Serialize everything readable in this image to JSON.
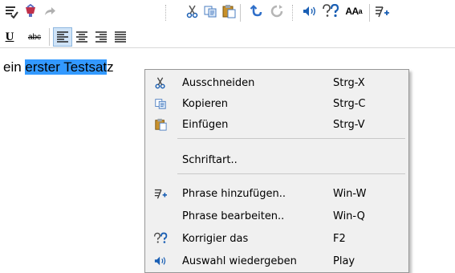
{
  "toolbar": {
    "icons": [
      "spell-check-icon",
      "paint-icon",
      "redo-arrow-icon",
      "cut-icon",
      "copy-icon",
      "paste-icon",
      "undo-icon",
      "refresh-icon",
      "speaker-icon",
      "correct-icon",
      "font-size-icon",
      "add-phrase-icon"
    ],
    "font_size_big": "AA",
    "font_size_small": "a",
    "underline_label": "U",
    "strikethrough_label": "abc"
  },
  "editor": {
    "text_before": "ein ",
    "text_selected": "erster Testsat",
    "text_after": "z"
  },
  "context_menu": {
    "items": [
      {
        "icon": "cut-icon",
        "label": "Ausschneiden",
        "shortcut": "Strg-X"
      },
      {
        "icon": "copy-icon",
        "label": "Kopieren",
        "shortcut": "Strg-C"
      },
      {
        "icon": "paste-icon",
        "label": "Einfügen",
        "shortcut": "Strg-V"
      },
      {
        "icon": "",
        "label": "Schriftart..",
        "shortcut": ""
      },
      {
        "icon": "add-phrase-icon",
        "label": "Phrase hinzufügen..",
        "shortcut": "Win-W"
      },
      {
        "icon": "",
        "label": "Phrase bearbeiten..",
        "shortcut": "Win-Q"
      },
      {
        "icon": "correct-icon",
        "label": "Korrigier das",
        "shortcut": "F2"
      },
      {
        "icon": "speaker-icon",
        "label": "Auswahl wiedergeben",
        "shortcut": "Play"
      }
    ]
  },
  "colors": {
    "selection": "#3399ff",
    "menu_background": "#f0f0f0",
    "icon_blue": "#1a5fb4"
  }
}
